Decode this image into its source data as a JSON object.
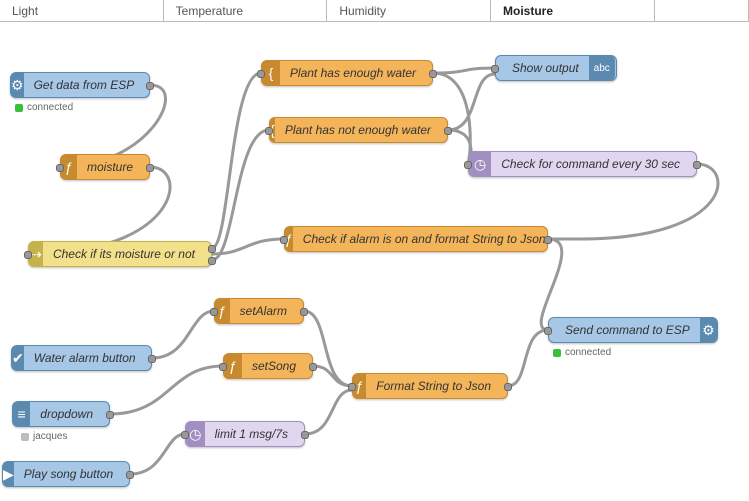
{
  "tabs": [
    "Light",
    "Temperature",
    "Humidity",
    "Moisture"
  ],
  "active_tab": "Moisture",
  "nodes": {
    "get_data": {
      "label": "Get data from ESP",
      "status": "connected",
      "status_color": "#3abf3a"
    },
    "moisture": {
      "label": "moisture"
    },
    "check_moist": {
      "label": "Check if its moisture or not"
    },
    "enough": {
      "label": "Plant has enough water"
    },
    "not_enough": {
      "label": "Plant has not enough water"
    },
    "show_output": {
      "label": "Show output"
    },
    "check_cmd": {
      "label": "Check for command every 30 sec"
    },
    "check_alarm": {
      "label": "Check if alarm is on and format String to Json"
    },
    "water_btn": {
      "label": "Water alarm button"
    },
    "set_alarm": {
      "label": "setAlarm"
    },
    "dropdown": {
      "label": "dropdown",
      "status": "jacques",
      "status_color": "#bdbdbd"
    },
    "set_song": {
      "label": "setSong"
    },
    "play_song": {
      "label": "Play song button"
    },
    "limit": {
      "label": "limit 1 msg/7s"
    },
    "format_json": {
      "label": "Format String to Json"
    },
    "send_cmd": {
      "label": "Send command to ESP",
      "status": "connected",
      "status_color": "#3abf3a"
    }
  },
  "icons": {
    "gear": "⚙",
    "brace": "{",
    "fx": "ƒ",
    "switch": "⇢",
    "check": "✔",
    "clock": "◷",
    "msg": "▦",
    "menu": "≡",
    "play": "▶",
    "abc": "abc"
  },
  "chart_data": {
    "type": "flowchart",
    "engine": "Node-RED",
    "nodes": [
      {
        "id": "get_data",
        "type": "mqtt-in",
        "label": "Get data from ESP"
      },
      {
        "id": "moisture",
        "type": "function",
        "label": "moisture"
      },
      {
        "id": "check_moist",
        "type": "switch",
        "label": "Check if its moisture or not"
      },
      {
        "id": "enough",
        "type": "change",
        "label": "Plant has enough water"
      },
      {
        "id": "not_enough",
        "type": "change",
        "label": "Plant has not enough water"
      },
      {
        "id": "show_output",
        "type": "ui-text",
        "label": "Show output"
      },
      {
        "id": "check_cmd",
        "type": "delay",
        "label": "Check for command every 30 sec"
      },
      {
        "id": "check_alarm",
        "type": "function",
        "label": "Check if alarm is on and format String to Json"
      },
      {
        "id": "water_btn",
        "type": "ui-switch",
        "label": "Water alarm button"
      },
      {
        "id": "set_alarm",
        "type": "function",
        "label": "setAlarm"
      },
      {
        "id": "dropdown",
        "type": "ui-dropdown",
        "label": "dropdown"
      },
      {
        "id": "set_song",
        "type": "function",
        "label": "setSong"
      },
      {
        "id": "play_song",
        "type": "ui-button",
        "label": "Play song button"
      },
      {
        "id": "limit",
        "type": "delay",
        "label": "limit 1 msg/7s"
      },
      {
        "id": "format_json",
        "type": "function",
        "label": "Format String to Json"
      },
      {
        "id": "send_cmd",
        "type": "mqtt-out",
        "label": "Send command to ESP"
      }
    ],
    "edges": [
      [
        "get_data",
        "moisture"
      ],
      [
        "moisture",
        "check_moist"
      ],
      [
        "check_moist",
        "enough"
      ],
      [
        "check_moist",
        "not_enough"
      ],
      [
        "enough",
        "show_output"
      ],
      [
        "not_enough",
        "show_output"
      ],
      [
        "enough",
        "check_cmd"
      ],
      [
        "not_enough",
        "check_cmd"
      ],
      [
        "check_cmd",
        "check_alarm"
      ],
      [
        "check_moist",
        "check_alarm"
      ],
      [
        "check_alarm",
        "send_cmd"
      ],
      [
        "water_btn",
        "set_alarm"
      ],
      [
        "dropdown",
        "set_song"
      ],
      [
        "set_alarm",
        "format_json"
      ],
      [
        "set_song",
        "format_json"
      ],
      [
        "play_song",
        "limit"
      ],
      [
        "limit",
        "format_json"
      ],
      [
        "format_json",
        "send_cmd"
      ]
    ]
  }
}
